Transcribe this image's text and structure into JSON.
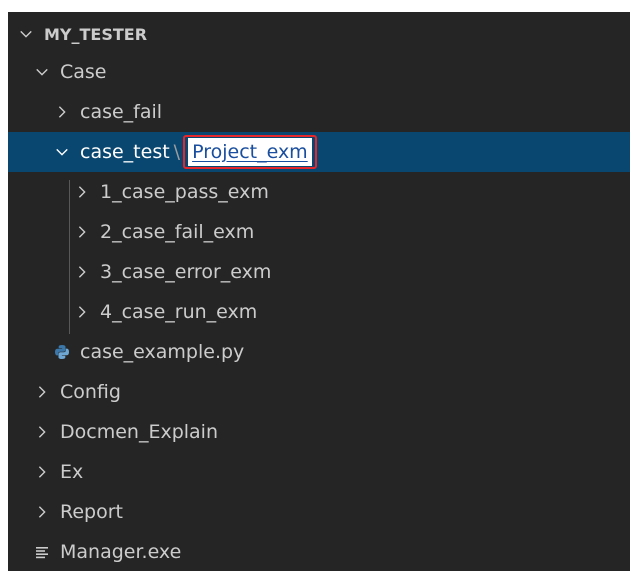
{
  "explorer": {
    "root_label": "MY_TESTER",
    "items": [
      {
        "label": "Case",
        "kind": "folder",
        "expanded": true
      },
      {
        "label": "case_fail",
        "kind": "folder",
        "expanded": false
      },
      {
        "label": "case_test",
        "kind": "folder",
        "expanded": true,
        "selected": true,
        "rename_value": "Project_exm"
      },
      {
        "label": "1_case_pass_exm",
        "kind": "folder",
        "expanded": false
      },
      {
        "label": "2_case_fail_exm",
        "kind": "folder",
        "expanded": false
      },
      {
        "label": "3_case_error_exm",
        "kind": "folder",
        "expanded": false
      },
      {
        "label": "4_case_run_exm",
        "kind": "folder",
        "expanded": false
      },
      {
        "label": "case_example.py",
        "kind": "file",
        "icon": "python-icon"
      },
      {
        "label": "Config",
        "kind": "folder",
        "expanded": false
      },
      {
        "label": "Docmen_Explain",
        "kind": "folder",
        "expanded": false
      },
      {
        "label": "Ex",
        "kind": "folder",
        "expanded": false
      },
      {
        "label": "Report",
        "kind": "folder",
        "expanded": false
      },
      {
        "label": "Manager.exe",
        "kind": "file",
        "icon": "lines-icon"
      }
    ],
    "separator": "\\"
  },
  "colors": {
    "background": "#252526",
    "selected_row": "#094771",
    "text": "#cccccc",
    "highlight_border": "#e5262b"
  }
}
